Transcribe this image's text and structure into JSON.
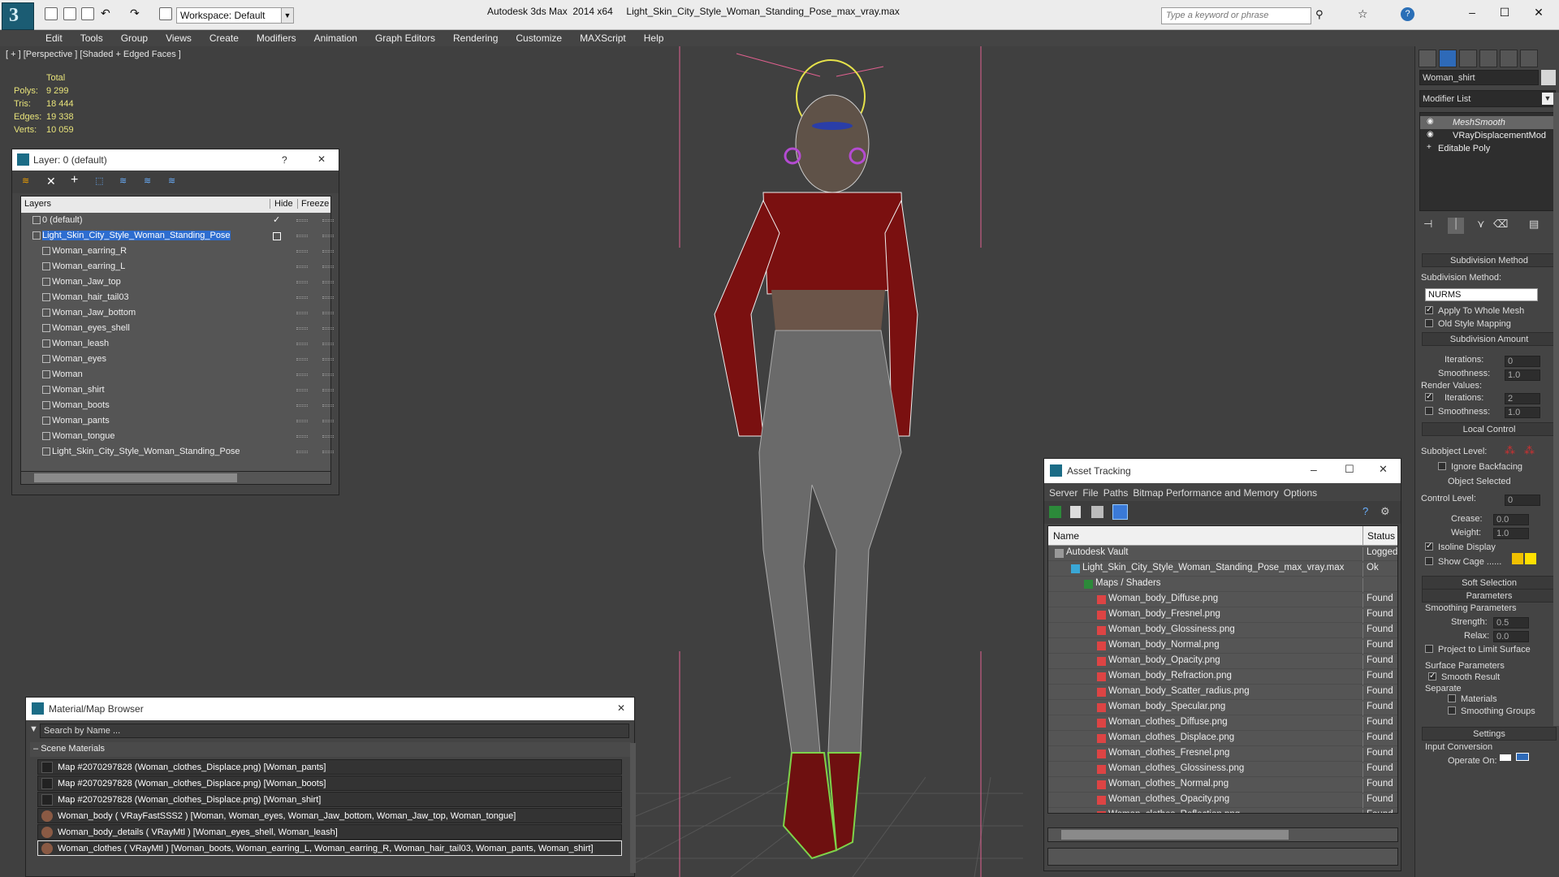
{
  "titlebar": {
    "app_logo": "3",
    "workspace": "Workspace: Default",
    "title": "Autodesk 3ds Max  2014 x64     Light_Skin_City_Style_Woman_Standing_Pose_max_vray.max",
    "search_placeholder": "Type a keyword or phrase"
  },
  "menu": [
    "Edit",
    "Tools",
    "Group",
    "Views",
    "Create",
    "Modifiers",
    "Animation",
    "Graph Editors",
    "Rendering",
    "Customize",
    "MAXScript",
    "Help"
  ],
  "viewport": {
    "label": "[ + ] [Perspective ] [Shaded + Edged Faces ]",
    "stats": {
      "header": "Total",
      "rows": [
        {
          "k": "Polys:",
          "v": "9 299"
        },
        {
          "k": "Tris:",
          "v": "18 444"
        },
        {
          "k": "Edges:",
          "v": "19 338"
        },
        {
          "k": "Verts:",
          "v": "10 059"
        }
      ]
    }
  },
  "layer_explorer": {
    "title": "Layer: 0 (default)",
    "help": "?",
    "close": "✕",
    "col_layers": "Layers",
    "col_hide": "Hide",
    "col_freeze": "Freeze",
    "rows": [
      {
        "name": "0 (default)",
        "indent": 1,
        "checked": true,
        "selected": false
      },
      {
        "name": "Light_Skin_City_Style_Woman_Standing_Pose",
        "indent": 1,
        "checked": false,
        "selected": true
      },
      {
        "name": "Woman_earring_R",
        "indent": 2
      },
      {
        "name": "Woman_earring_L",
        "indent": 2
      },
      {
        "name": "Woman_Jaw_top",
        "indent": 2
      },
      {
        "name": "Woman_hair_tail03",
        "indent": 2
      },
      {
        "name": "Woman_Jaw_bottom",
        "indent": 2
      },
      {
        "name": "Woman_eyes_shell",
        "indent": 2
      },
      {
        "name": "Woman_leash",
        "indent": 2
      },
      {
        "name": "Woman_eyes",
        "indent": 2
      },
      {
        "name": "Woman",
        "indent": 2
      },
      {
        "name": "Woman_shirt",
        "indent": 2
      },
      {
        "name": "Woman_boots",
        "indent": 2
      },
      {
        "name": "Woman_pants",
        "indent": 2
      },
      {
        "name": "Woman_tongue",
        "indent": 2
      },
      {
        "name": "Light_Skin_City_Style_Woman_Standing_Pose",
        "indent": 2
      }
    ]
  },
  "material_browser": {
    "title": "Material/Map Browser",
    "close": "✕",
    "search_placeholder": "Search by Name ...",
    "group": "Scene Materials",
    "rows": [
      "Map #2070297828 (Woman_clothes_Displace.png) [Woman_pants]",
      "Map #2070297828 (Woman_clothes_Displace.png) [Woman_boots]",
      "Map #2070297828 (Woman_clothes_Displace.png) [Woman_shirt]",
      "Woman_body  ( VRayFastSSS2 ) [Woman, Woman_eyes, Woman_Jaw_bottom, Woman_Jaw_top, Woman_tongue]",
      "Woman_body_details  ( VRayMtl ) [Woman_eyes_shell, Woman_leash]",
      "Woman_clothes  ( VRayMtl ) [Woman_boots, Woman_earring_L, Woman_earring_R, Woman_hair_tail03, Woman_pants, Woman_shirt]"
    ]
  },
  "asset_tracking": {
    "title": "Asset Tracking",
    "menu": [
      "Server",
      "File",
      "Paths",
      "Bitmap Performance and Memory",
      "Options"
    ],
    "col_name": "Name",
    "col_status": "Status",
    "rows": [
      {
        "name": "Autodesk Vault",
        "status": "Logged O",
        "indent": 0,
        "icon": "vault"
      },
      {
        "name": "Light_Skin_City_Style_Woman_Standing_Pose_max_vray.max",
        "status": "Ok",
        "indent": 1,
        "icon": "max"
      },
      {
        "name": "Maps / Shaders",
        "status": "",
        "indent": 2,
        "icon": "maps"
      },
      {
        "name": "Woman_body_Diffuse.png",
        "status": "Found",
        "indent": 3,
        "icon": "png"
      },
      {
        "name": "Woman_body_Fresnel.png",
        "status": "Found",
        "indent": 3,
        "icon": "png"
      },
      {
        "name": "Woman_body_Glossiness.png",
        "status": "Found",
        "indent": 3,
        "icon": "png"
      },
      {
        "name": "Woman_body_Normal.png",
        "status": "Found",
        "indent": 3,
        "icon": "png"
      },
      {
        "name": "Woman_body_Opacity.png",
        "status": "Found",
        "indent": 3,
        "icon": "png"
      },
      {
        "name": "Woman_body_Refraction.png",
        "status": "Found",
        "indent": 3,
        "icon": "png"
      },
      {
        "name": "Woman_body_Scatter_radius.png",
        "status": "Found",
        "indent": 3,
        "icon": "png"
      },
      {
        "name": "Woman_body_Specular.png",
        "status": "Found",
        "indent": 3,
        "icon": "png"
      },
      {
        "name": "Woman_clothes_Diffuse.png",
        "status": "Found",
        "indent": 3,
        "icon": "png"
      },
      {
        "name": "Woman_clothes_Displace.png",
        "status": "Found",
        "indent": 3,
        "icon": "png"
      },
      {
        "name": "Woman_clothes_Fresnel.png",
        "status": "Found",
        "indent": 3,
        "icon": "png"
      },
      {
        "name": "Woman_clothes_Glossiness.png",
        "status": "Found",
        "indent": 3,
        "icon": "png"
      },
      {
        "name": "Woman_clothes_Normal.png",
        "status": "Found",
        "indent": 3,
        "icon": "png"
      },
      {
        "name": "Woman_clothes_Opacity.png",
        "status": "Found",
        "indent": 3,
        "icon": "png"
      },
      {
        "name": "Woman_clothes_Reflection.png",
        "status": "Found",
        "indent": 3,
        "icon": "png"
      }
    ]
  },
  "command_panel": {
    "object_name": "Woman_shirt",
    "modifier_list": "Modifier List",
    "stack": [
      "MeshSmooth",
      "VRayDisplacementMod",
      "Editable Poly"
    ],
    "subdivision_method": {
      "header": "Subdivision Method",
      "label": "Subdivision Method:",
      "value": "NURMS",
      "apply_whole": "Apply To Whole Mesh",
      "old_style": "Old Style Mapping"
    },
    "subdivision_amount": {
      "header": "Subdivision Amount",
      "iterations_label": "Iterations:",
      "iterations": "0",
      "smoothness_label": "Smoothness:",
      "smoothness": "1.0",
      "render_values": "Render Values:",
      "r_iterations_label": "Iterations:",
      "r_iterations": "2",
      "r_smoothness_label": "Smoothness:",
      "r_smoothness": "1.0"
    },
    "local_control": {
      "header": "Local Control",
      "subobject": "Subobject Level:",
      "ignore_backfacing": "Ignore Backfacing",
      "object_selected": "Object Selected",
      "control_level_label": "Control Level:",
      "control_level": "0",
      "crease_label": "Crease:",
      "crease": "0.0",
      "weight_label": "Weight:",
      "weight": "1.0",
      "isoline": "Isoline Display",
      "show_cage": "Show Cage ......"
    },
    "soft_selection": "Soft Selection",
    "parameters": {
      "header": "Parameters",
      "smoothing": "Smoothing Parameters",
      "strength_label": "Strength:",
      "strength": "0.5",
      "relax_label": "Relax:",
      "relax": "0.0",
      "project": "Project to Limit Surface",
      "surface": "Surface Parameters",
      "smooth_result": "Smooth Result",
      "separate": "Separate",
      "materials": "Materials",
      "smoothing_groups": "Smoothing Groups"
    },
    "settings": {
      "header": "Settings",
      "input_conversion": "Input Conversion",
      "operate_on": "Operate On:"
    },
    "colors": {
      "cage_1": "#f0c000",
      "cage_2": "#ffe000"
    }
  }
}
